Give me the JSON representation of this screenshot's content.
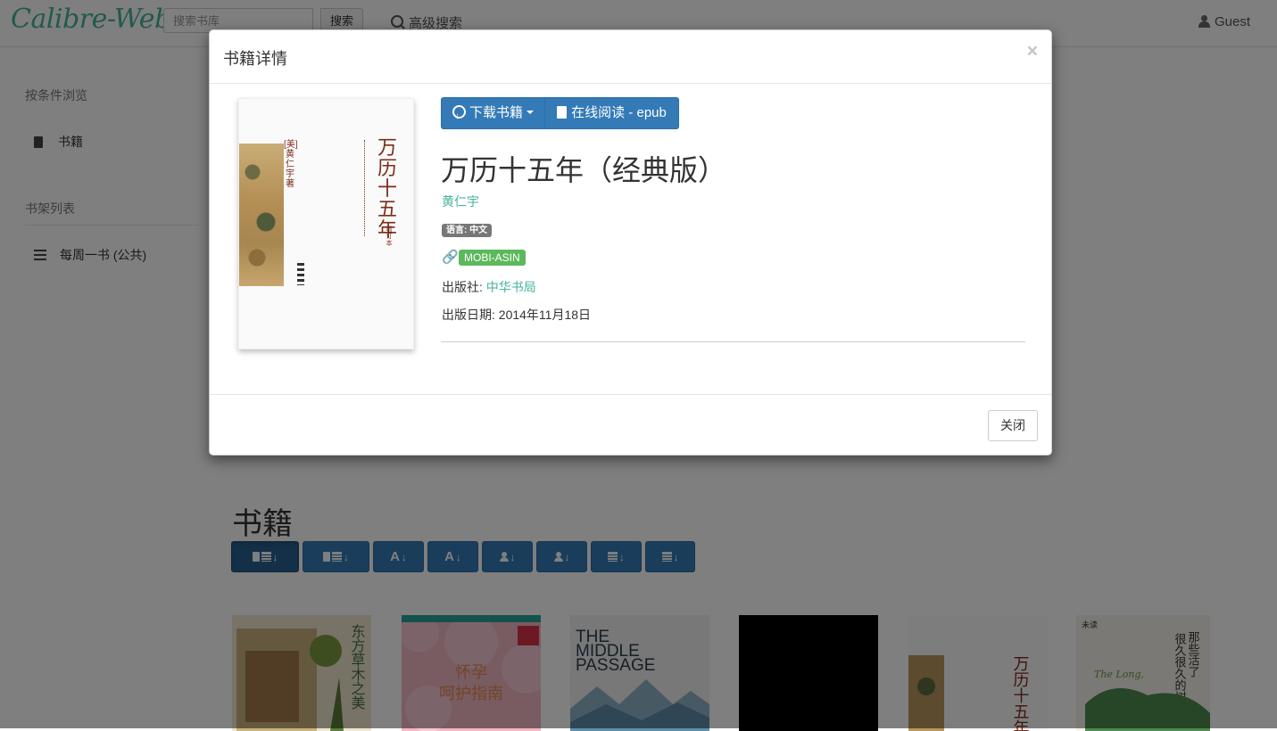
{
  "app": {
    "logo": "Calibre-Web",
    "user": "Guest"
  },
  "search": {
    "placeholder": "搜索书库",
    "button": "搜索",
    "advanced": "高级搜索"
  },
  "sidebar": {
    "browse_heading": "按条件浏览",
    "browse_items": [
      {
        "label": "书籍",
        "icon": "book-icon"
      }
    ],
    "shelves_heading": "书架列表",
    "shelf_items": [
      {
        "label": "每周一书 (公共)",
        "icon": "list-icon"
      }
    ]
  },
  "main": {
    "title": "书籍",
    "sort_buttons": [
      {
        "name": "sort-newest",
        "icons": [
          "book-icon",
          "calendar-icon",
          "sort-desc-icon"
        ],
        "active": true
      },
      {
        "name": "sort-oldest",
        "icons": [
          "book-icon",
          "calendar-icon",
          "sort-asc-icon"
        ]
      },
      {
        "name": "sort-title-az",
        "icons": [
          "A",
          "sort-az-icon"
        ]
      },
      {
        "name": "sort-title-za",
        "icons": [
          "A",
          "sort-za-icon"
        ]
      },
      {
        "name": "sort-author-az",
        "icons": [
          "user-icon",
          "sort-az-icon"
        ]
      },
      {
        "name": "sort-author-za",
        "icons": [
          "user-icon",
          "sort-za-icon"
        ]
      },
      {
        "name": "sort-pubdate-asc",
        "icons": [
          "calendar-icon",
          "sort-asc-icon"
        ]
      },
      {
        "name": "sort-pubdate-desc",
        "icons": [
          "calendar-icon",
          "sort-desc-icon"
        ]
      }
    ],
    "covers": [
      {
        "title": "东方草木之美"
      },
      {
        "title": "怀孕呵护指南"
      },
      {
        "title": "THE MIDDLE PASSAGE"
      },
      {
        "title": ""
      },
      {
        "title": "万历十五年"
      },
      {
        "title": "那些活了很久很久的树"
      }
    ]
  },
  "modal": {
    "title": "书籍详情",
    "close_x": "×",
    "download_label": "下载书籍",
    "read_label": "在线阅读 - epub",
    "book_title": "万历十五年（经典版）",
    "author": "黄仁宇",
    "language_badge": "语言: 中文",
    "identifier_badge": "MOBI-ASIN",
    "publisher_label": "出版社: ",
    "publisher": "中华书局",
    "pubdate_label": "出版日期: ",
    "pubdate": "2014年11月18日",
    "close_button": "关闭",
    "cover": {
      "title": "万历十五年",
      "author": "[美] 黄仁宇 著",
      "edition": "增订本"
    }
  },
  "colors": {
    "primary": "#337ab7",
    "accent": "#45b29d",
    "success": "#5cb85c",
    "badge": "#777777"
  }
}
